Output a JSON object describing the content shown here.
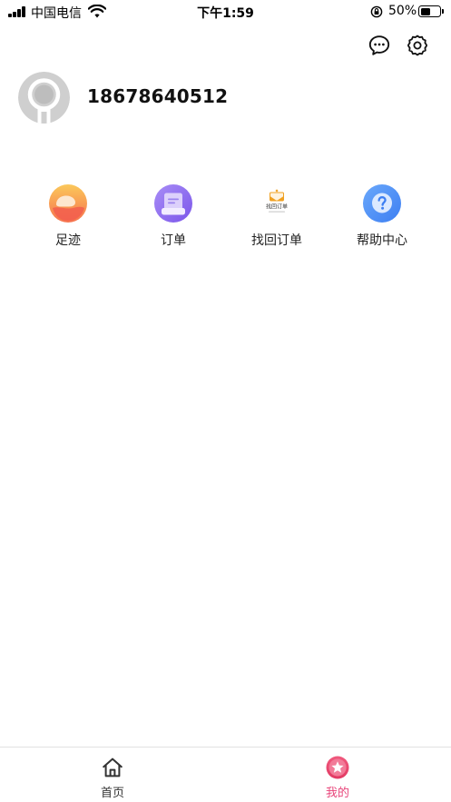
{
  "status_bar": {
    "carrier": "中国电信",
    "time": "下午1:59",
    "battery_percent_label": "50%",
    "battery_level": 0.5
  },
  "profile": {
    "phone": "18678640512"
  },
  "menu": {
    "items": [
      {
        "label": "足迹",
        "icon": "footprint-icon",
        "color": "#f7a04a"
      },
      {
        "label": "订单",
        "icon": "order-icon",
        "color": "#9a6cf0"
      },
      {
        "label": "找回订单",
        "icon": "retrieve-order-icon",
        "thumb_text": "找回订单",
        "color": "#f0a020"
      },
      {
        "label": "帮助中心",
        "icon": "help-icon",
        "color": "#4d8ff5"
      }
    ]
  },
  "tabbar": {
    "tabs": [
      {
        "label": "首页",
        "icon": "home-icon",
        "active": false
      },
      {
        "label": "我的",
        "icon": "star-badge-icon",
        "active": true
      }
    ],
    "active_color": "#e8457a",
    "inactive_color": "#333333"
  }
}
